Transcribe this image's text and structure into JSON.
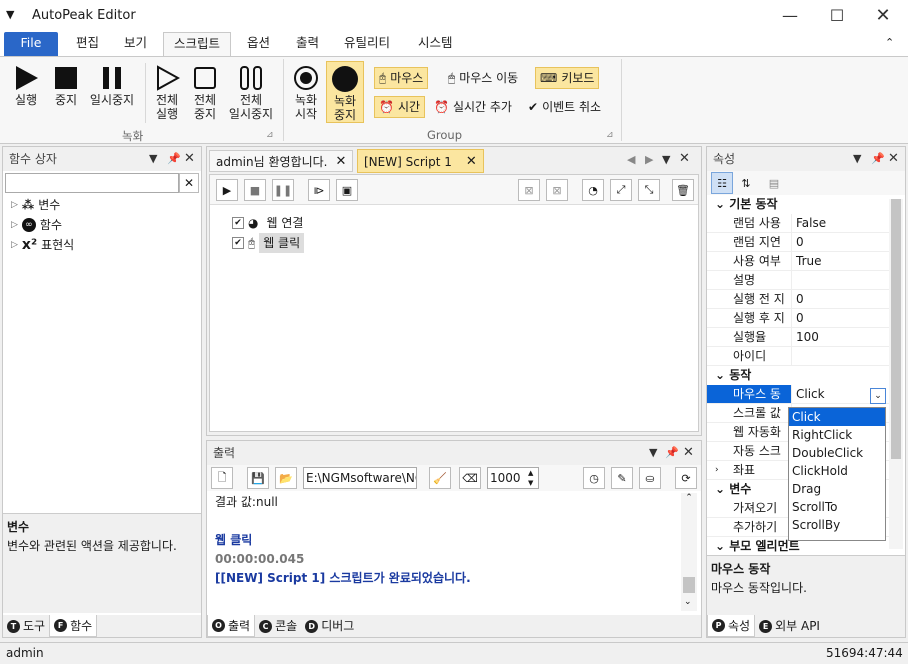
{
  "window": {
    "title": "AutoPeak Editor"
  },
  "menu": {
    "file": "File",
    "tabs": [
      "편집",
      "보기",
      "스크립트",
      "옵션",
      "출력",
      "유틸리티",
      "시스템"
    ]
  },
  "ribbon": {
    "record_group": {
      "run": "실행",
      "stop": "중지",
      "pause": "일시중지",
      "all_run": [
        "전체",
        "실행"
      ],
      "all_stop": [
        "전체",
        "중지"
      ],
      "all_pause": [
        "전체",
        "일시중지"
      ],
      "label": "녹화"
    },
    "group2": {
      "rec_start": [
        "녹화",
        "시작"
      ],
      "rec_stop": [
        "녹화",
        "중지"
      ],
      "mouse": "마우스",
      "mouse_move": "마우스 이동",
      "keyboard": "키보드",
      "time": "시간",
      "realtime_add": "실시간 추가",
      "event_cancel": "이벤트 취소",
      "label": "Group"
    }
  },
  "func_box": {
    "title": "함수 상자",
    "items": [
      "변수",
      "함수",
      "표현식"
    ],
    "desc_title": "변수",
    "desc_text": "변수와 관련된 액션을 제공합니다.",
    "tabs": [
      "도구",
      "함수"
    ]
  },
  "doc_tabs": [
    "admin님 환영합니다.",
    "[NEW] Script 1"
  ],
  "script_items": [
    "웹 연결",
    "웹 클릭"
  ],
  "output": {
    "title": "출력",
    "path": "E:\\NGMsoftware\\NG",
    "count": "1000",
    "lines": {
      "result": "결과 값:null",
      "web_click": "웹 클릭",
      "elapsed": "00:00:00.045",
      "done": "[[NEW] Script 1] 스크립트가 완료되었습니다."
    },
    "tabs": [
      "출력",
      "콘솔",
      "디버그"
    ]
  },
  "properties": {
    "title": "속성",
    "cat_basic": "기본 동작",
    "basic_rows": [
      {
        "k": "랜덤 사용",
        "v": "False"
      },
      {
        "k": "랜덤 지연",
        "v": "0"
      },
      {
        "k": "사용 여부",
        "v": "True"
      },
      {
        "k": "설명",
        "v": ""
      },
      {
        "k": "실행 전 지",
        "v": "0"
      },
      {
        "k": "실행 후 지",
        "v": "0"
      },
      {
        "k": "실행율",
        "v": "100"
      },
      {
        "k": "아이디",
        "v": ""
      }
    ],
    "cat_action": "동작",
    "action_rows": [
      {
        "k": "마우스 동",
        "v": "Click"
      },
      {
        "k": "스크롤 값",
        "v": ""
      },
      {
        "k": "웹 자동화",
        "v": ""
      },
      {
        "k": "자동 스크",
        "v": ""
      },
      {
        "k": "좌표",
        "v": ""
      }
    ],
    "cat_var": "변수",
    "var_rows": [
      {
        "k": "가져오기",
        "v": ""
      },
      {
        "k": "추가하기",
        "v": ""
      }
    ],
    "cat_parent": "부모 엘리먼트",
    "dropdown": [
      "Click",
      "RightClick",
      "DoubleClick",
      "ClickHold",
      "Drag",
      "ScrollTo",
      "ScrollBy"
    ],
    "desc_title": "마우스 동작",
    "desc_text": "마우스 동작입니다.",
    "tabs": [
      "속성",
      "외부 API"
    ]
  },
  "status": {
    "user": "admin",
    "time": "51694:47:44"
  },
  "colors": {
    "file_tab": "#2a67c8",
    "highlight": "#fbe6a0",
    "selection": "#0a64d8",
    "output_blue": "#1a3aa0"
  }
}
